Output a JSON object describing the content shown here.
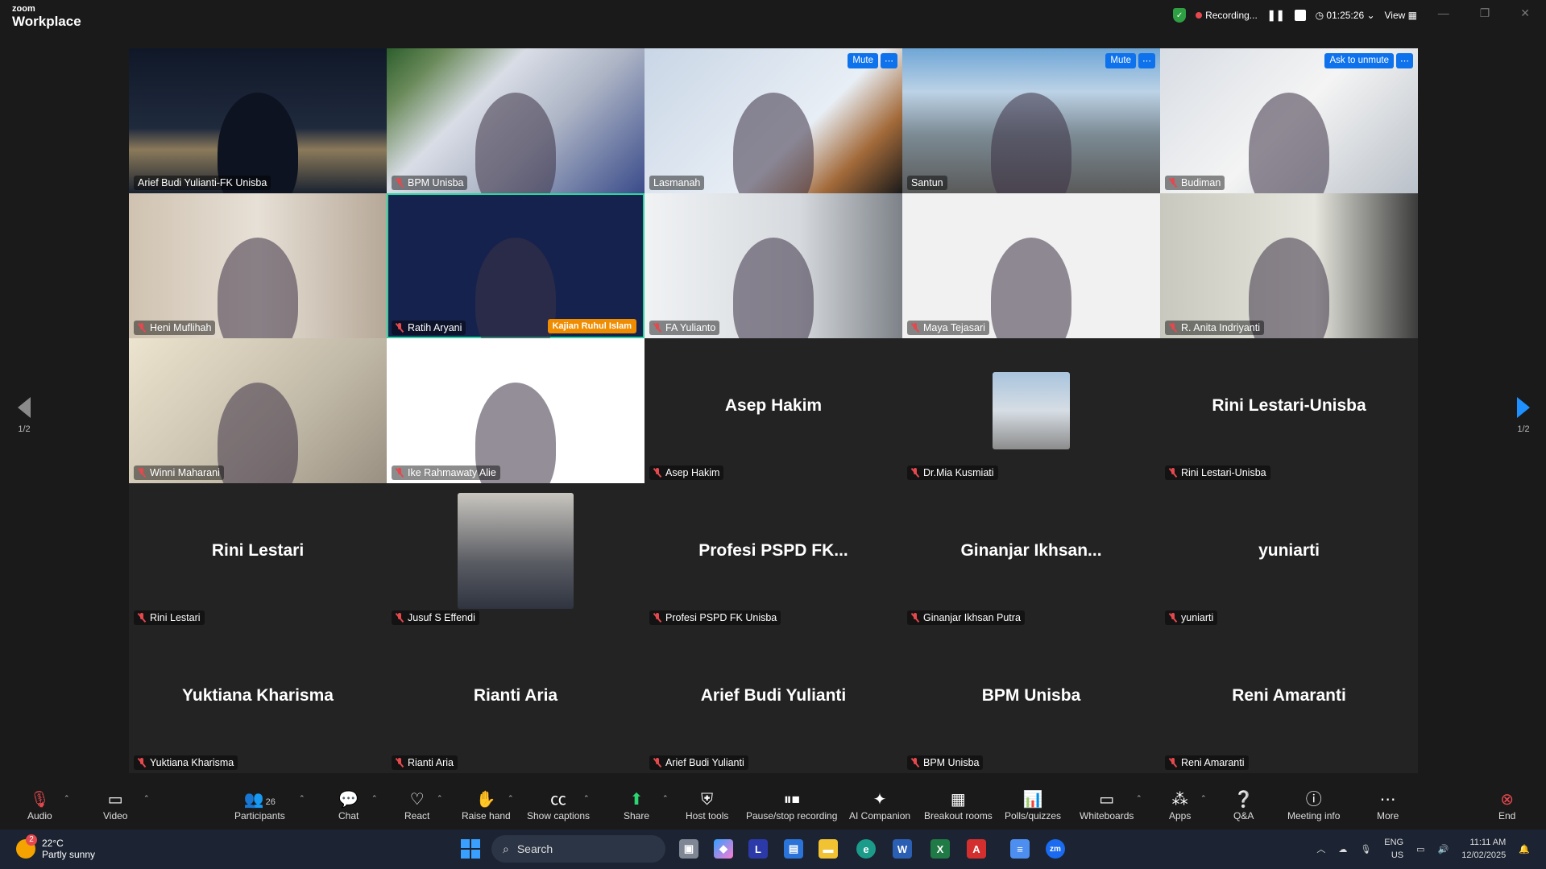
{
  "app": {
    "brand_small": "zoom",
    "brand_big": "Workplace"
  },
  "topbar": {
    "recording_label": "Recording...",
    "timer": "01:25:26",
    "view_label": "View"
  },
  "tiles": [
    {
      "name": "Arief Budi Yulianti-FK Unisba",
      "muted": false,
      "kind": "video",
      "bg": "pic-night"
    },
    {
      "name": "BPM Unisba",
      "muted": true,
      "kind": "video",
      "bg": "pic-building"
    },
    {
      "name": "Lasmanah",
      "muted": false,
      "kind": "video",
      "bg": "pic-lasma",
      "overlay": "Mute"
    },
    {
      "name": "Santun",
      "muted": false,
      "kind": "video",
      "bg": "pic-city",
      "overlay": "Mute"
    },
    {
      "name": "Budiman",
      "muted": true,
      "kind": "video",
      "bg": "pic-budiman",
      "overlay": "Ask to unmute"
    },
    {
      "name": "Heni Muflihah",
      "muted": true,
      "kind": "video",
      "bg": "pic-heni"
    },
    {
      "name": "Ratih Aryani",
      "muted": true,
      "kind": "video",
      "bg": "pic-ratih",
      "active": true,
      "badge": "Kajian Ruhul Islam"
    },
    {
      "name": "FA Yulianto",
      "muted": true,
      "kind": "video",
      "bg": "pic-fa"
    },
    {
      "name": "Maya Tejasari",
      "muted": true,
      "kind": "video",
      "bg": "pic-maya"
    },
    {
      "name": "R. Anita Indriyanti",
      "muted": true,
      "kind": "video",
      "bg": "pic-anita"
    },
    {
      "name": "Winni Maharani",
      "muted": true,
      "kind": "video",
      "bg": "pic-winni"
    },
    {
      "name": "Ike Rahmawaty Alie",
      "muted": true,
      "kind": "video",
      "bg": "pic-ike"
    },
    {
      "name": "Asep Hakim",
      "muted": true,
      "kind": "name",
      "display": "Asep Hakim"
    },
    {
      "name": "Dr.Mia Kusmiati",
      "muted": true,
      "kind": "avatar"
    },
    {
      "name": "Rini Lestari-Unisba",
      "muted": true,
      "kind": "name",
      "display": "Rini Lestari-Unisba"
    },
    {
      "name": "Rini Lestari",
      "muted": true,
      "kind": "name",
      "display": "Rini Lestari"
    },
    {
      "name": "Jusuf S Effendi",
      "muted": true,
      "kind": "avatar"
    },
    {
      "name": "Profesi PSPD FK Unisba",
      "muted": true,
      "kind": "name",
      "display": "Profesi PSPD FK..."
    },
    {
      "name": "Ginanjar Ikhsan Putra",
      "muted": true,
      "kind": "name",
      "display": "Ginanjar  Ikhsan..."
    },
    {
      "name": "yuniarti",
      "muted": true,
      "kind": "name",
      "display": "yuniarti"
    },
    {
      "name": "Yuktiana Kharisma",
      "muted": true,
      "kind": "name",
      "display": "Yuktiana Kharisma"
    },
    {
      "name": "Rianti Aria",
      "muted": true,
      "kind": "name",
      "display": "Rianti Aria"
    },
    {
      "name": "Arief Budi Yulianti",
      "muted": true,
      "kind": "name",
      "display": "Arief Budi Yulianti"
    },
    {
      "name": "BPM Unisba",
      "muted": true,
      "kind": "name",
      "display": "BPM Unisba"
    },
    {
      "name": "Reni Amaranti",
      "muted": true,
      "kind": "name",
      "display": "Reni Amaranti"
    }
  ],
  "pager": {
    "left": "1/2",
    "right": "1/2"
  },
  "toolbar": {
    "audio": "Audio",
    "video": "Video",
    "participants": "Participants",
    "participants_count": "26",
    "chat": "Chat",
    "react": "React",
    "raise_hand": "Raise hand",
    "captions": "Show captions",
    "share": "Share",
    "host_tools": "Host tools",
    "pause_recording": "Pause/stop recording",
    "ai_companion": "AI Companion",
    "breakout": "Breakout rooms",
    "polls": "Polls/quizzes",
    "whiteboards": "Whiteboards",
    "apps": "Apps",
    "qa": "Q&A",
    "meeting_info": "Meeting info",
    "more": "More",
    "end": "End"
  },
  "taskbar": {
    "weather_temp": "22°C",
    "weather_desc": "Partly sunny",
    "weather_badge": "2",
    "search_placeholder": "Search",
    "lang_1": "ENG",
    "lang_2": "US",
    "time": "11:11 AM",
    "date": "12/02/2025"
  },
  "colors": {
    "accent": "#0e72ed",
    "active_border": "#2bd5a0",
    "muted": "#e5484d",
    "share": "#2ed573"
  }
}
